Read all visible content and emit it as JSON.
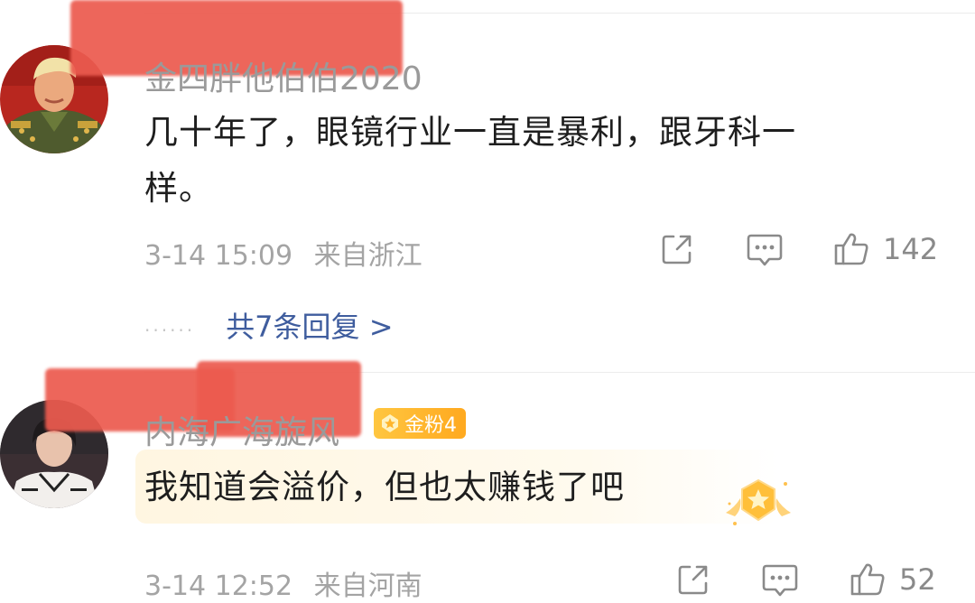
{
  "comments": [
    {
      "username": "金四胖他伯伯2020",
      "text_line1": "几十年了，眼镜行业一直是暴利，跟牙科一",
      "text_line2": "样。",
      "time": "3-14 15:09",
      "location": "来自浙江",
      "likes": "142",
      "replies_label": "共7条回复 >",
      "replies_dots": "......"
    },
    {
      "username": "内海广海旋风",
      "badge": "金粉4",
      "text": "我知道会溢价，但也太赚钱了吧",
      "time": "3-14 12:52",
      "location": "来自河南",
      "likes": "52"
    }
  ],
  "icons": {
    "share": "share-icon",
    "comment": "comment-icon",
    "like": "thumbs-up-icon",
    "badge": "star-badge-icon",
    "decoration": "gold-medal-icon"
  },
  "colors": {
    "link": "#3f5d9e",
    "redaction": "#ec5b4f",
    "badge": "#ffb52b",
    "meta": "#a4a4a4"
  }
}
